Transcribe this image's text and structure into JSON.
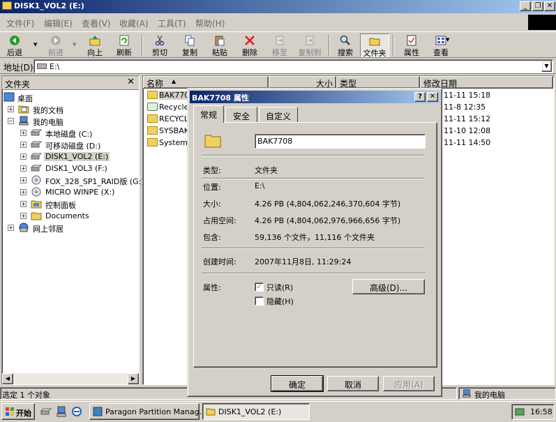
{
  "window": {
    "title": "DISK1_VOL2 (E:)"
  },
  "menu": [
    "文件(F)",
    "编辑(E)",
    "查看(V)",
    "收藏(A)",
    "工具(T)",
    "帮助(H)"
  ],
  "toolbar": {
    "back": "后退",
    "forward": "前进",
    "up": "向上",
    "refresh": "刷新",
    "cut": "剪切",
    "copy": "复制",
    "paste": "粘贴",
    "delete": "删除",
    "move_to": "移至",
    "copy_to": "复制到",
    "search": "搜索",
    "folders": "文件夹",
    "properties": "属性",
    "view": "查看"
  },
  "address": {
    "label": "地址(D)",
    "value": "E:\\"
  },
  "folder_pane": {
    "title": "文件夹",
    "items": [
      "桌面",
      "我的文档",
      "我的电脑",
      "本地磁盘 (C:)",
      "可移动磁盘 (D:)",
      "DISK1_VOL2 (E:)",
      "DISK1_VOL3 (F:)",
      "FOX_328_SP1_RAID版 (G:)",
      "MICRO WINPE (X:)",
      "控制面板",
      "Documents",
      "网上邻居"
    ]
  },
  "file_list": {
    "columns": [
      "名称",
      "大小",
      "类型",
      "修改日期"
    ],
    "rows": [
      {
        "name": "BAK7708",
        "date": "11-11 15:18"
      },
      {
        "name": "Recycled",
        "date": "11-8 12:35"
      },
      {
        "name": "RECYCLER",
        "date": "11-11 15:12"
      },
      {
        "name": "SYSBAK",
        "date": "11-10 12:08"
      },
      {
        "name": "System V",
        "date": "11-11 14:50"
      }
    ]
  },
  "dialog": {
    "title": "BAK7708 属性",
    "tabs": [
      "常规",
      "安全",
      "自定义"
    ],
    "name_value": "BAK7708",
    "type_label": "类型:",
    "type_value": "文件夹",
    "location_label": "位置:",
    "location_value": "E:\\",
    "size_label": "大小:",
    "size_value": "4.26 PB (4,804,062,246,370,604 字节)",
    "size_on_disk_label": "占用空间:",
    "size_on_disk_value": "4.26 PB (4,804,062,976,966,656 字节)",
    "contains_label": "包含:",
    "contains_value": "59,136 个文件，11,116 个文件夹",
    "created_label": "创建时间:",
    "created_value": "2007年11月8日, 11:29:24",
    "attributes_label": "属性:",
    "readonly_label": "只读(R)",
    "hidden_label": "隐藏(H)",
    "advanced_button": "高级(D)...",
    "ok_button": "确定",
    "cancel_button": "取消",
    "apply_button": "应用(A)"
  },
  "status": {
    "left": "选定 1 个对象",
    "right": "我的电脑"
  },
  "taskbar": {
    "start": "开始",
    "tasks": [
      "Paragon Partition Manag...",
      "DISK1_VOL2 (E:)"
    ],
    "clock": "16:58"
  }
}
